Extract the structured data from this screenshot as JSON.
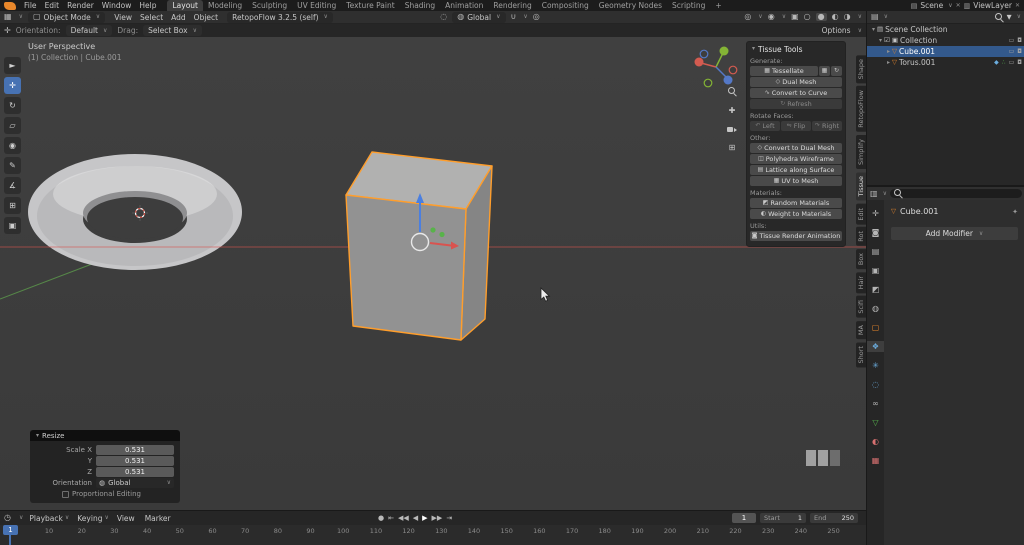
{
  "colors": {
    "accent": "#4772b3",
    "selection_outline": "#ff9e2c",
    "object_orange": "#e8872b",
    "modifier_blue": "#6badde",
    "data_green": "#55b24c",
    "axis_red": "#d9534f",
    "axis_green": "#61a84e"
  },
  "icons": {
    "dropdown": "∨",
    "collapse": "▾",
    "expand": "▸",
    "close": "✕",
    "checkbox": "☑",
    "editor_3d": "▦",
    "editor_outliner": "▤",
    "editor_props": "▥",
    "clock": "◷",
    "mode": "▢",
    "pivot": "◌",
    "globe": "◍",
    "magnet": "∪",
    "proportional": "◎",
    "gizmo": "◎",
    "overlays": "◉",
    "xray": "▣",
    "shade_wire": "○",
    "shade_solid": "●",
    "shade_material": "◐",
    "shade_render": "◑",
    "funnel": "▼",
    "scene_collection": "▤",
    "collection": "▣",
    "mesh_data": "▽",
    "wrench": "◆",
    "nodes": "∴",
    "screen": "▭",
    "camera": "◘",
    "pin": "✦",
    "ortho": "⊞",
    "hand": "✚",
    "record": "●",
    "jump_start": "⇤",
    "prev_key": "◀◀",
    "play_back": "◀",
    "play": "▶",
    "next_key": "▶▶",
    "jump_end": "⇥"
  },
  "topbar": {
    "menus": [
      "File",
      "Edit",
      "Render",
      "Window",
      "Help"
    ],
    "workspaces": [
      {
        "label": "Layout",
        "active": true
      },
      {
        "label": "Modeling"
      },
      {
        "label": "Sculpting"
      },
      {
        "label": "UV Editing"
      },
      {
        "label": "Texture Paint"
      },
      {
        "label": "Shading"
      },
      {
        "label": "Animation"
      },
      {
        "label": "Rendering"
      },
      {
        "label": "Compositing"
      },
      {
        "label": "Geometry Nodes"
      },
      {
        "label": "Scripting"
      },
      {
        "label": "+"
      }
    ],
    "scene_label": "Scene",
    "viewlayer_label": "ViewLayer"
  },
  "viewport_header": {
    "mode": "Object Mode",
    "menus": [
      "View",
      "Select",
      "Add",
      "Object"
    ],
    "addon_dropdown": "RetopoFlow 3.2.5 (self)",
    "transform_orientation": "Global"
  },
  "tool_settings": {
    "orientation_label": "Orientation:",
    "orientation_value": "Default",
    "drag_label": "Drag:",
    "drag_value": "Select Box",
    "options_label": "Options"
  },
  "viewport": {
    "view_label": "User Perspective",
    "collection_breadcrumb": "(1) Collection | Cube.001"
  },
  "toolbar": {
    "tools": [
      {
        "glyph": "►"
      },
      {
        "glyph": "✛",
        "active": true
      },
      {
        "glyph": "↻"
      },
      {
        "glyph": "▱"
      },
      {
        "glyph": "◉"
      },
      {
        "glyph": "✎"
      },
      {
        "glyph": "∡"
      },
      {
        "glyph": "⊞"
      },
      {
        "glyph": "▣"
      }
    ]
  },
  "tissue_panel": {
    "title": "Tissue Tools",
    "generate_label": "Generate:",
    "tessellate": {
      "glyph": "▦",
      "label": "Tessellate"
    },
    "tessellate_extra1": "▦",
    "tessellate_extra2": "↻",
    "dual_mesh": {
      "glyph": "◇",
      "label": "Dual Mesh"
    },
    "convert_to_curve": {
      "glyph": "∿",
      "label": "Convert to Curve"
    },
    "refresh": {
      "glyph": "↻",
      "label": "Refresh"
    },
    "rotate_faces_label": "Rotate Faces:",
    "rotate_buttons": [
      {
        "glyph": "↶",
        "label": "Left"
      },
      {
        "glyph": "⇋",
        "label": "Flip"
      },
      {
        "glyph": "↷",
        "label": "Right"
      }
    ],
    "other_label": "Other:",
    "other_buttons": [
      {
        "glyph": "◇",
        "label": "Convert to Dual Mesh"
      },
      {
        "glyph": "◫",
        "label": "Polyhedra Wireframe"
      },
      {
        "glyph": "▤",
        "label": "Lattice along Surface"
      },
      {
        "glyph": "▦",
        "label": "UV to Mesh"
      }
    ],
    "materials_label": "Materials:",
    "material_buttons": [
      {
        "glyph": "◩",
        "label": "Random Materials"
      },
      {
        "glyph": "◐",
        "label": "Weight to Materials"
      }
    ],
    "utils_label": "Utils:",
    "utils_button": {
      "glyph": "◙",
      "label": "Tissue Render Animation"
    }
  },
  "side_tabs": [
    {
      "label": "Shape"
    },
    {
      "label": "RetopoFlow"
    },
    {
      "label": "Simplify"
    },
    {
      "label": "Tissue",
      "active": true
    },
    {
      "label": "Edit"
    },
    {
      "label": "Rot"
    },
    {
      "label": "Box"
    },
    {
      "label": "Hair"
    },
    {
      "label": "Scifi"
    },
    {
      "label": "MA"
    },
    {
      "label": "Short"
    }
  ],
  "outliner": {
    "scene_collection": "Scene Collection",
    "collection": "Collection",
    "cube": "Cube.001",
    "torus": "Torus.001"
  },
  "properties": {
    "object_name": "Cube.001",
    "add_modifier": "Add Modifier",
    "tabs": [
      {
        "name": "tool",
        "glyph": "✛"
      },
      {
        "name": "render",
        "glyph": "◙"
      },
      {
        "name": "output",
        "glyph": "▤"
      },
      {
        "name": "view-layer",
        "glyph": "▣"
      },
      {
        "name": "scene",
        "glyph": "◩"
      },
      {
        "name": "world",
        "glyph": "◍"
      },
      {
        "name": "object",
        "glyph": "▢"
      },
      {
        "name": "modifiers",
        "glyph": "❖",
        "active": true
      },
      {
        "name": "particles",
        "glyph": "✳"
      },
      {
        "name": "physics",
        "glyph": "◌"
      },
      {
        "name": "constraints",
        "glyph": "∞"
      },
      {
        "name": "object-data",
        "glyph": "▽"
      },
      {
        "name": "material",
        "glyph": "◐"
      },
      {
        "name": "texture",
        "glyph": "▦"
      }
    ]
  },
  "resize_panel": {
    "title": "Resize",
    "fields": [
      {
        "label": "Scale X",
        "value": "0.531"
      },
      {
        "label": "Y",
        "value": "0.531"
      },
      {
        "label": "Z",
        "value": "0.531"
      }
    ],
    "orientation_label": "Orientation",
    "orientation_value": "Global",
    "proportional_label": "Proportional Editing"
  },
  "timeline": {
    "menus": [
      {
        "label": "Playback",
        "chev": "∨"
      },
      {
        "label": "Keying",
        "chev": "∨"
      },
      {
        "label": "View",
        "chev": ""
      },
      {
        "label": "Marker",
        "chev": ""
      }
    ],
    "frame_current": "1",
    "start_label": "Start",
    "start_value": "1",
    "end_label": "End",
    "end_value": "250",
    "scrubber_frame": "1",
    "ruler": [
      "0",
      "10",
      "20",
      "30",
      "40",
      "50",
      "60",
      "70",
      "80",
      "90",
      "100",
      "110",
      "120",
      "130",
      "140",
      "150",
      "160",
      "170",
      "180",
      "190",
      "200",
      "210",
      "220",
      "230",
      "240",
      "250"
    ]
  }
}
